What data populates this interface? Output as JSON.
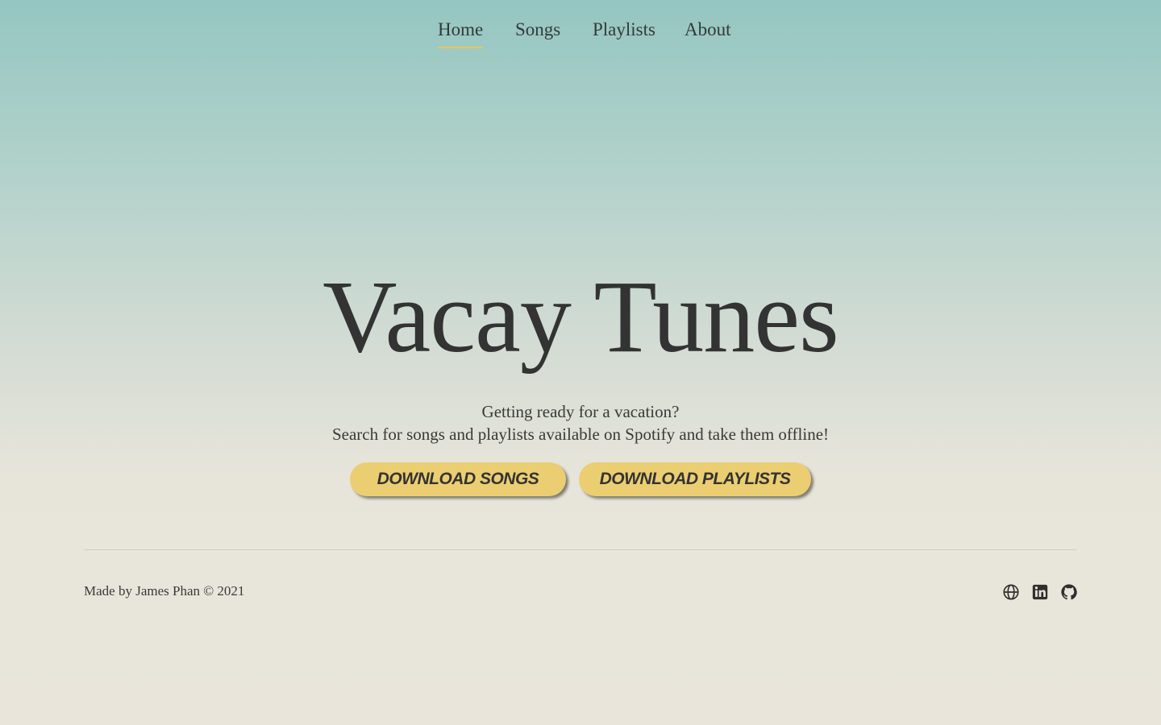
{
  "nav": {
    "items": [
      {
        "label": "Home",
        "active": true
      },
      {
        "label": "Songs",
        "active": false
      },
      {
        "label": "Playlists",
        "active": false
      },
      {
        "label": "About",
        "active": false
      }
    ]
  },
  "hero": {
    "title": "Vacay Tunes",
    "tagline_line1": "Getting ready for a vacation?",
    "tagline_line2": "Search for songs and playlists available on Spotify and take them offline!",
    "buttons": {
      "songs": "DOWNLOAD SONGS",
      "playlists": "DOWNLOAD PLAYLISTS"
    }
  },
  "footer": {
    "credit": "Made by James Phan © 2021",
    "social_icons": [
      "globe-icon",
      "linkedin-icon",
      "github-icon"
    ]
  },
  "colors": {
    "gradient_top": "#95c6c1",
    "gradient_bottom": "#e9e5db",
    "button_fill": "#ecce72",
    "active_underline": "#e8c45e",
    "text": "#333333"
  }
}
